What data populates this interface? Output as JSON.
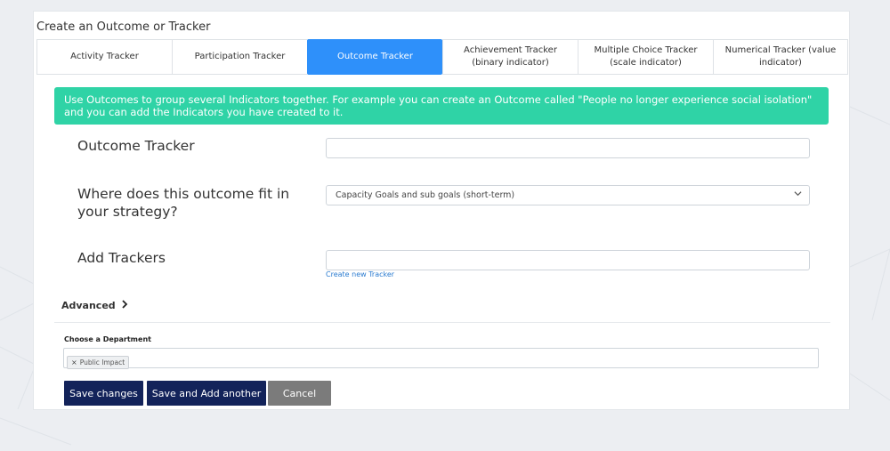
{
  "dialog": {
    "title": "Create an Outcome or Tracker"
  },
  "tabs": [
    {
      "label": "Activity Tracker",
      "active": false
    },
    {
      "label": "Participation Tracker",
      "active": false
    },
    {
      "label": "Outcome Tracker",
      "active": true
    },
    {
      "label": "Achievement Tracker (binary indicator)",
      "active": false
    },
    {
      "label": "Multiple Choice Tracker (scale indicator)",
      "active": false
    },
    {
      "label": "Numerical Tracker (value indicator)",
      "active": false
    }
  ],
  "info_banner": "Use Outcomes to group several Indicators together. For example you can create an Outcome called \"People no longer experience social isolation\" and you can add the Indicators you have created to it.",
  "form": {
    "outcome_tracker_label": "Outcome Tracker",
    "outcome_tracker_value": "",
    "strategy_label": "Where does this outcome fit in your strategy?",
    "strategy_selected": "Capacity Goals and sub goals (short-term)",
    "add_trackers_label": "Add Trackers",
    "add_trackers_value": "",
    "create_tracker_link": "Create new Tracker",
    "advanced_label": "Advanced",
    "department_label": "Choose a Department",
    "department_tags": [
      "Public Impact"
    ]
  },
  "buttons": {
    "save": "Save changes",
    "save_add": "Save and Add another",
    "cancel": "Cancel"
  },
  "colors": {
    "active_tab": "#2e90fa",
    "banner": "#2fd3a6",
    "primary_button": "#13235a",
    "cancel_button": "#7b7b7b"
  }
}
